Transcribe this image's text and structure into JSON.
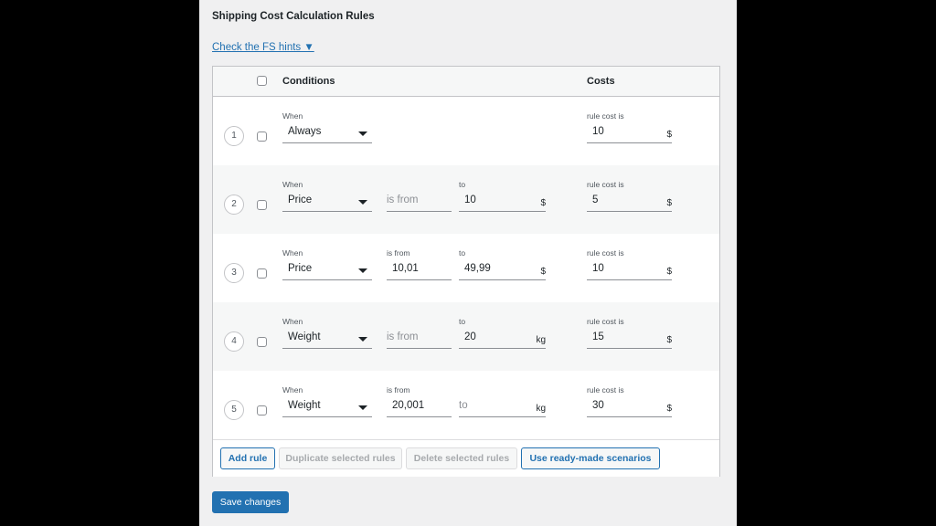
{
  "section_title": "Shipping Cost Calculation Rules",
  "hints_link": "Check the FS hints ▼",
  "table": {
    "header": {
      "conditions": "Conditions",
      "costs": "Costs"
    },
    "rules": [
      {
        "number": "1",
        "when_label": "When",
        "condition": "Always",
        "cost_label": "rule cost is",
        "cost": "10",
        "cost_unit": "$"
      },
      {
        "number": "2",
        "when_label": "When",
        "condition": "Price",
        "from_placeholder": "is from",
        "to_label": "to",
        "to_value": "10",
        "range_unit": "$",
        "cost_label": "rule cost is",
        "cost": "5",
        "cost_unit": "$"
      },
      {
        "number": "3",
        "when_label": "When",
        "condition": "Price",
        "from_label": "is from",
        "from_value": "10,01",
        "to_label": "to",
        "to_value": "49,99",
        "range_unit": "$",
        "cost_label": "rule cost is",
        "cost": "10",
        "cost_unit": "$"
      },
      {
        "number": "4",
        "when_label": "When",
        "condition": "Weight",
        "from_placeholder": "is from",
        "to_label": "to",
        "to_value": "20",
        "range_unit": "kg",
        "cost_label": "rule cost is",
        "cost": "15",
        "cost_unit": "$"
      },
      {
        "number": "5",
        "when_label": "When",
        "condition": "Weight",
        "from_label": "is from",
        "from_value": "20,001",
        "to_placeholder": "to",
        "range_unit": "kg",
        "cost_label": "rule cost is",
        "cost": "30",
        "cost_unit": "$"
      }
    ]
  },
  "buttons": {
    "add_rule": "Add rule",
    "duplicate": "Duplicate selected rules",
    "delete": "Delete selected rules",
    "scenarios": "Use ready-made scenarios",
    "save": "Save changes"
  }
}
